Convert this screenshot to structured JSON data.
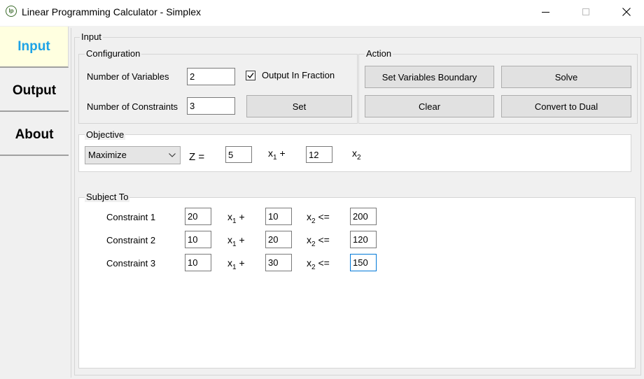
{
  "window": {
    "title": "Linear Programming Calculator - Simplex",
    "app_icon_text": "lp",
    "minimize_glyph": "—",
    "maximize_glyph": "☐",
    "close_glyph": "✕"
  },
  "nav": {
    "tabs": [
      {
        "label": "Input",
        "active": true
      },
      {
        "label": "Output",
        "active": false
      },
      {
        "label": "About",
        "active": false
      }
    ],
    "active_color": "#1ea3e6",
    "active_bg": "#ffffe0"
  },
  "input_group": {
    "label": "Input",
    "configuration": {
      "label": "Configuration",
      "num_variables_label": "Number of Variables",
      "num_variables_value": "2",
      "output_fraction_label": "Output In  Fraction",
      "output_fraction_checked": true,
      "num_constraints_label": "Number of Constraints",
      "num_constraints_value": "3",
      "set_button": "Set"
    },
    "action": {
      "label": "Action",
      "set_boundary_button": "Set Variables Boundary",
      "solve_button": "Solve",
      "clear_button": "Clear",
      "dual_button": "Convert to Dual"
    },
    "objective": {
      "label": "Objective",
      "goal": "Maximize",
      "z_label": "Z  =",
      "coefficients": [
        "5",
        "12"
      ],
      "var1_base": "x",
      "var1_sub": "1",
      "var1_suffix": " +",
      "var2_base": "x",
      "var2_sub": "2"
    },
    "subject_to": {
      "label": "Subject To",
      "constraints": [
        {
          "label": "Constraint 1",
          "coefs": [
            "20",
            "10"
          ],
          "rhs": "200"
        },
        {
          "label": "Constraint 2",
          "coefs": [
            "10",
            "20"
          ],
          "rhs": "120"
        },
        {
          "label": "Constraint 3",
          "coefs": [
            "10",
            "30"
          ],
          "rhs": "150"
        }
      ],
      "x1_base": "x",
      "x1_sub": "1",
      "x1_suffix": " +",
      "x2_base": "x",
      "x2_sub": "2",
      "x2_suffix": " <="
    }
  }
}
